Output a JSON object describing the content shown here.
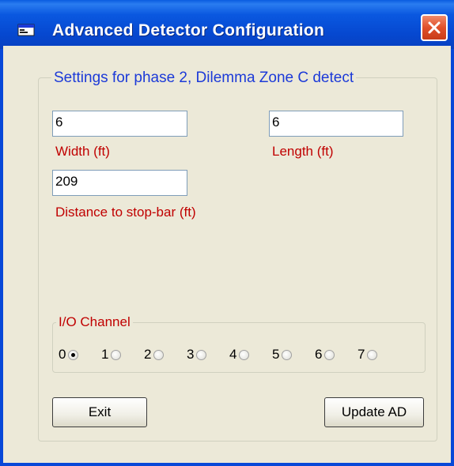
{
  "window": {
    "title": "Advanced Detector Configuration",
    "icon": "app-window-icon",
    "close_icon": "close-x-icon"
  },
  "settings_group": {
    "title": "Settings for phase 2, Dilemma Zone C detect"
  },
  "fields": {
    "width": {
      "value": "6",
      "label": "Width (ft)"
    },
    "length": {
      "value": "6",
      "label": "Length (ft)"
    },
    "distance": {
      "value": "209",
      "label": "Distance to stop-bar (ft)"
    }
  },
  "io_channel": {
    "title": "I/O Channel",
    "options": [
      "0",
      "1",
      "2",
      "3",
      "4",
      "5",
      "6",
      "7"
    ],
    "selected": "0"
  },
  "buttons": {
    "exit": "Exit",
    "update": "Update AD"
  },
  "colors": {
    "title_bar": "#0a58e0",
    "group_title": "#1c3ad8",
    "field_label": "#c00000",
    "dialog_bg": "#ece9d8",
    "close_button": "#e0502a"
  }
}
